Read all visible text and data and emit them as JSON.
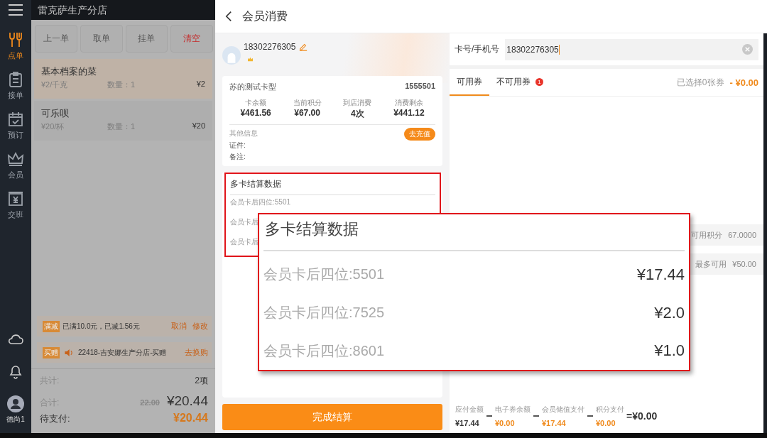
{
  "sidebar": {
    "items": [
      {
        "label": "点单",
        "kind": "utensils",
        "selected": true
      },
      {
        "label": "接单",
        "kind": "clipboard",
        "selected": false
      },
      {
        "label": "预订",
        "kind": "calendar",
        "selected": false
      },
      {
        "label": "会员",
        "kind": "crown",
        "selected": false
      },
      {
        "label": "交班",
        "kind": "register",
        "selected": false
      }
    ],
    "user": "德尚1"
  },
  "order_panel": {
    "store": "雷克萨生产分店",
    "buttons": [
      {
        "label": "上一单",
        "kind": "normal"
      },
      {
        "label": "取单",
        "kind": "normal"
      },
      {
        "label": "挂单",
        "kind": "normal"
      },
      {
        "label": "清空",
        "kind": "danger"
      }
    ],
    "items": [
      {
        "name": "基本档案的菜",
        "unit_price": "¥2/千克",
        "quantity": "数量：1",
        "amount": "¥2",
        "selected": true
      },
      {
        "name": "可乐呗",
        "unit_price": "¥20/杯",
        "quantity": "数量：1",
        "amount": "¥20",
        "selected": false
      }
    ],
    "promotions": [
      {
        "tag": "满减",
        "speaker": false,
        "text": "已满10.0元，已减1.56元",
        "actions": [
          "取消",
          "修改"
        ]
      },
      {
        "tag": "买赠",
        "speaker": true,
        "text": "22418-吉安娜生产分店-买赠",
        "actions": [
          "去换购"
        ]
      }
    ],
    "totals": {
      "count_label": "共计:",
      "count": "2项",
      "sum_label": "合计:",
      "original": "22.00",
      "sum": "¥20.44",
      "due_label": "待支付:",
      "due": "¥20.44"
    }
  },
  "header": {
    "title": "会员消费"
  },
  "member": {
    "phone": "18302276305",
    "card_type": "苏的测试卡型",
    "card_no": "1555501",
    "stats": [
      {
        "label": "卡余额",
        "value": "¥461.56"
      },
      {
        "label": "当前积分",
        "value": "¥67.00"
      },
      {
        "label": "到店消费",
        "value": "4次"
      },
      {
        "label": "消费剩余",
        "value": "¥441.12"
      }
    ],
    "other_label": "其他信息",
    "recharge": "去充值",
    "id_label": "证件:",
    "note_label": "备注:"
  },
  "multi_card": {
    "title": "多卡结算数据",
    "rows": [
      {
        "label": "会员卡后四位:5501"
      },
      {
        "label": "会员卡后"
      },
      {
        "label": "会员卡后"
      }
    ]
  },
  "zoom_overlay": {
    "title": "多卡结算数据",
    "rows": [
      {
        "label": "会员卡后四位:5501",
        "amount": "¥17.44"
      },
      {
        "label": "会员卡后四位:7525",
        "amount": "¥2.0"
      },
      {
        "label": "会员卡后四位:8601",
        "amount": "¥1.0"
      }
    ]
  },
  "complete_button": "完成结算",
  "coupons": {
    "field_label": "卡号/手机号",
    "value": "18302276305",
    "tabs": [
      {
        "label": "可用券",
        "selected": true
      },
      {
        "label": "不可用券",
        "selected": false,
        "badge": "1"
      }
    ],
    "summary": "已选择0张券",
    "discount": "- ¥0.00",
    "points": [
      {
        "label": "可用积分",
        "value": "67.0000"
      },
      {
        "label": "最多可用",
        "value": "¥50.00"
      }
    ]
  },
  "formula": {
    "terms": [
      {
        "label": "应付金额",
        "value": "¥17.44",
        "highlight": false
      },
      {
        "label": "电子券余额",
        "value": "¥0.00",
        "highlight": true
      },
      {
        "label": "会员储值支付",
        "value": "¥17.44",
        "highlight": true
      },
      {
        "label": "积分支付",
        "value": "¥0.00",
        "highlight": true
      }
    ],
    "result": "=¥0.00"
  }
}
